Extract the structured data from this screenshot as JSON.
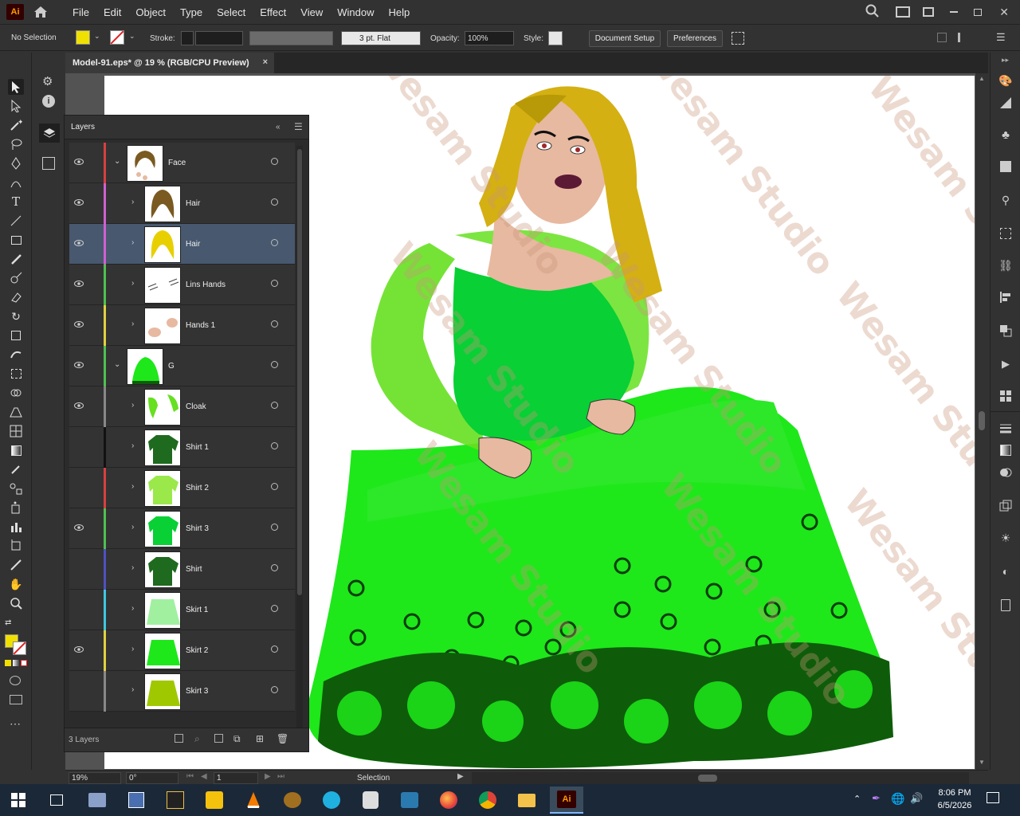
{
  "menubar": {
    "app_logo": "Ai",
    "items": [
      "File",
      "Edit",
      "Object",
      "Type",
      "Select",
      "Effect",
      "View",
      "Window",
      "Help"
    ]
  },
  "controlbar": {
    "selection_status": "No Selection",
    "fill_color": "#f0e000",
    "stroke_label": "Stroke:",
    "brush_value": "3 pt. Flat",
    "opacity_label": "Opacity:",
    "opacity_value": "100%",
    "style_label": "Style:",
    "document_setup": "Document Setup",
    "preferences": "Preferences"
  },
  "document": {
    "tab_title": "Model-91.eps* @ 19 % (RGB/CPU Preview)",
    "close": "×"
  },
  "layers_panel": {
    "title": "Layers",
    "count_label": "3 Layers",
    "rows": [
      {
        "name": "Face",
        "color": "#d84040",
        "level": 0,
        "expanded": true,
        "visible": true,
        "selected": false,
        "thumb": "face"
      },
      {
        "name": "Hair",
        "color": "#d060d0",
        "level": 1,
        "expanded": false,
        "visible": true,
        "selected": false,
        "thumb": "hair-brown"
      },
      {
        "name": "Hair",
        "color": "#d060d0",
        "level": 1,
        "expanded": false,
        "visible": true,
        "selected": true,
        "thumb": "hair-yellow"
      },
      {
        "name": "Lins Hands",
        "color": "#50c050",
        "level": 1,
        "expanded": false,
        "visible": true,
        "selected": false,
        "thumb": "lines"
      },
      {
        "name": "Hands 1",
        "color": "#e0d040",
        "level": 1,
        "expanded": false,
        "visible": true,
        "selected": false,
        "thumb": "hands"
      },
      {
        "name": "G",
        "color": "#50c050",
        "level": 0,
        "expanded": true,
        "visible": true,
        "selected": false,
        "thumb": "dress"
      },
      {
        "name": "Cloak",
        "color": "#888888",
        "level": 1,
        "expanded": false,
        "visible": true,
        "selected": false,
        "thumb": "cloak"
      },
      {
        "name": "Shirt 1",
        "color": "#111111",
        "level": 1,
        "expanded": false,
        "visible": false,
        "selected": false,
        "thumb": "shirt-dark"
      },
      {
        "name": "Shirt 2",
        "color": "#d84040",
        "level": 1,
        "expanded": false,
        "visible": false,
        "selected": false,
        "thumb": "shirt-light"
      },
      {
        "name": "Shirt 3",
        "color": "#50c050",
        "level": 1,
        "expanded": false,
        "visible": true,
        "selected": false,
        "thumb": "shirt-green"
      },
      {
        "name": "Shirt",
        "color": "#5050c0",
        "level": 1,
        "expanded": false,
        "visible": false,
        "selected": false,
        "thumb": "shirt-dark"
      },
      {
        "name": "Skirt 1",
        "color": "#40c8e0",
        "level": 1,
        "expanded": false,
        "visible": false,
        "selected": false,
        "thumb": "skirt-pale"
      },
      {
        "name": "Skirt 2",
        "color": "#e0d040",
        "level": 1,
        "expanded": false,
        "visible": true,
        "selected": false,
        "thumb": "skirt-green"
      },
      {
        "name": "Skirt 3",
        "color": "#888888",
        "level": 1,
        "expanded": false,
        "visible": false,
        "selected": false,
        "thumb": "skirt-olive"
      }
    ]
  },
  "statusbar": {
    "zoom": "19%",
    "rotation": "0°",
    "artboard_number": "1",
    "tool": "Selection"
  },
  "watermark": "Wesam Studio",
  "taskbar": {
    "time": "8:06 PM",
    "date": "6/5/2026"
  }
}
